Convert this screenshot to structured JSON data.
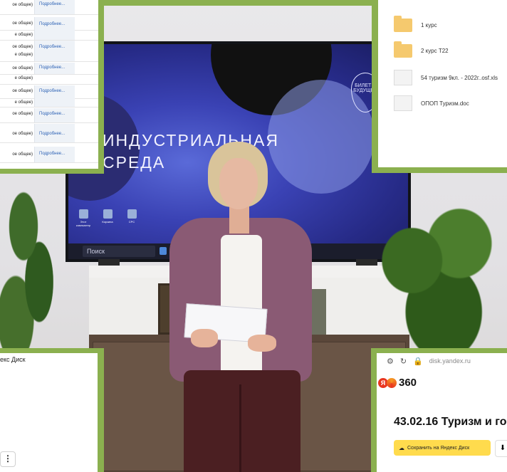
{
  "photo": {
    "tv_title_line1": "ИНДУСТРИАЛЬНАЯ",
    "tv_title_line2": "СРЕДА",
    "tv_logo_text": "БИЛЕТ В БУДУЩЕЕ",
    "desktop_icons": [
      "Этот компьютер",
      "Корзина",
      "CPC"
    ],
    "taskbar_search": "Поиск"
  },
  "top_left_table": {
    "rows": [
      {
        "label": "ое общее)",
        "link": "Подробнее..."
      },
      {
        "label": "ое общее)",
        "link": "Подробнее..."
      },
      {
        "label": "е общее)",
        "link": ""
      },
      {
        "label": "ое общее)",
        "link": "Подробнее..."
      },
      {
        "label": "е общее)",
        "link": ""
      },
      {
        "label": "ое общее)",
        "link": "Подробнее..."
      },
      {
        "label": "е общее)",
        "link": ""
      },
      {
        "label": "ое общее)",
        "link": "Подробнее..."
      },
      {
        "label": "е общее)",
        "link": ""
      },
      {
        "label": "ое общее)",
        "link": "Подробнее..."
      },
      {
        "label": "ое общее)",
        "link": "Подробнее..."
      },
      {
        "label": "ое общее)",
        "link": "Подробнее..."
      }
    ]
  },
  "top_right_files": {
    "items": [
      {
        "type": "folder",
        "name": "1 курс"
      },
      {
        "type": "folder",
        "name": "2 курс Т22"
      },
      {
        "type": "file",
        "name": "54 туризм 9кл. - 2022г..osf.xls"
      },
      {
        "type": "file",
        "name": "ОПОП Туризм.doc"
      }
    ]
  },
  "bottom_left": {
    "title": "екс Диск",
    "more_label": "⋮"
  },
  "bottom_right": {
    "url": "disk.yandex.ru",
    "brand_letter": "Я",
    "brand": "360",
    "heading": "43.02.16 Туризм и го",
    "save_label": "Сохранить на Яндекс Диск",
    "download_icon": "⬇"
  },
  "colors": {
    "frame_green": "#8bb04f",
    "link_blue": "#2d62b5",
    "yandex_yellow": "#ffdb4d",
    "yandex_red": "#e8351f",
    "folder_yellow": "#f5c96e"
  }
}
